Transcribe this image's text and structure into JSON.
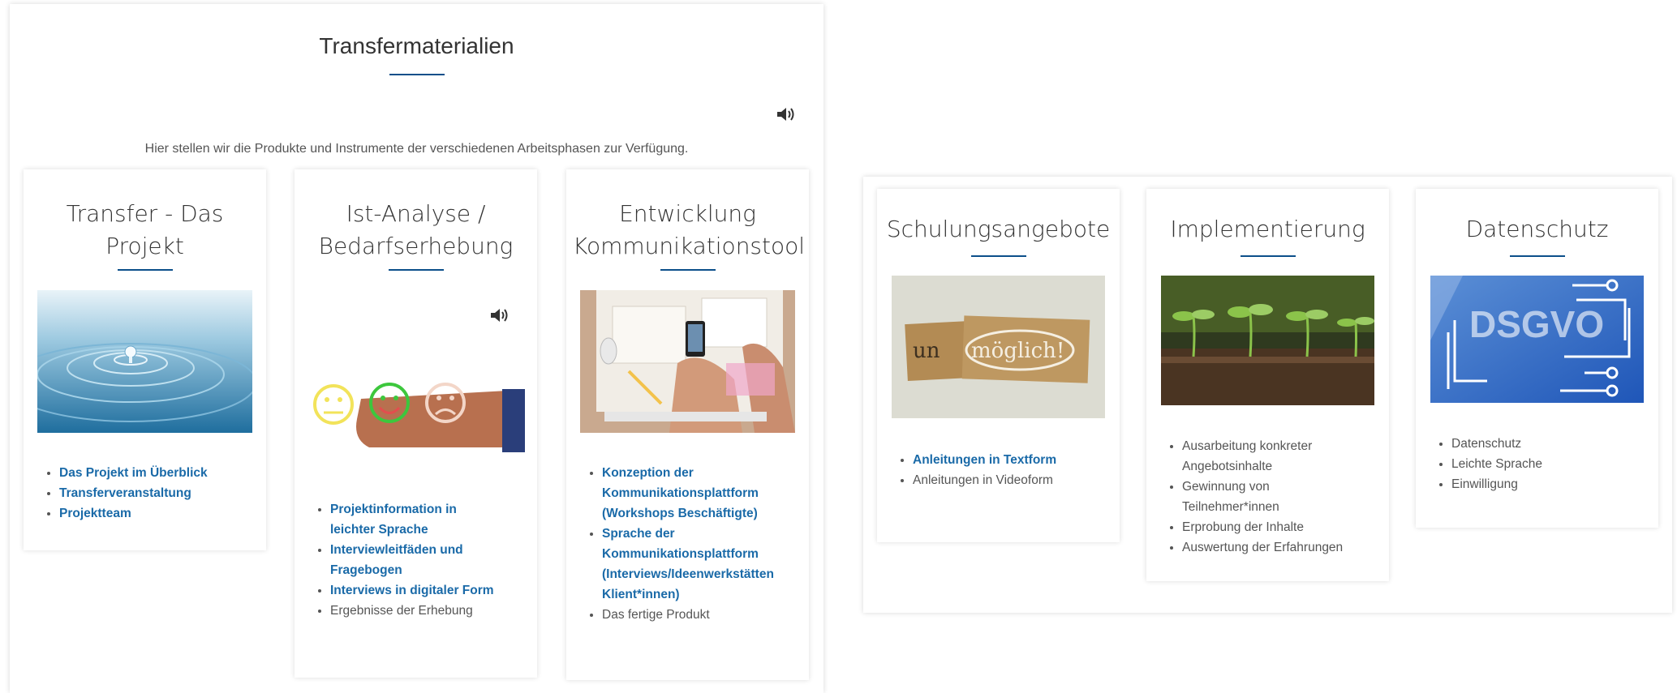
{
  "left_panel": {
    "title": "Transfermaterialien",
    "intro": "Hier stellen wir die Produkte und Instrumente der verschiedenen Arbeitsphasen zur Verfügung.",
    "cards": [
      {
        "title_line1": "Transfer - Das",
        "title_line2": "Projekt",
        "items": [
          {
            "text": "Das Projekt im Überblick",
            "link": true
          },
          {
            "text": "Transferveranstaltung",
            "link": true
          },
          {
            "text": "Projektteam",
            "link": true
          }
        ]
      },
      {
        "title_line1": "Ist-Analyse /",
        "title_line2": "Bedarfserhebung",
        "items": [
          {
            "line1": "Projektinformation in",
            "line2": "leichter Sprache",
            "link": true
          },
          {
            "line1": "Interviewleitfäden und",
            "line2": "Fragebogen",
            "link": true
          },
          {
            "text": "Interviews in digitaler Form",
            "link": true
          },
          {
            "text": "Ergebnisse der Erhebung",
            "link": false
          }
        ]
      },
      {
        "title_line1": "Entwicklung",
        "title_line2": "Kommunikationstool",
        "items": [
          {
            "line1": "Konzeption der",
            "line2": "Kommunikationsplattform",
            "line3": "(Workshops Beschäftigte)",
            "link": true
          },
          {
            "line1": "Sprache der",
            "line2": "Kommunikationsplattform",
            "line3": "(Interviews/Ideenwerkstätten",
            "line4": "Klient*innen)",
            "link": true
          },
          {
            "text": "Das fertige Produkt",
            "link": false
          }
        ]
      }
    ]
  },
  "right_panel": {
    "cards": [
      {
        "title": "Schulungsangebote",
        "image_text_1": "un",
        "image_text_2": "möglich!",
        "items": [
          {
            "text": "Anleitungen in Textform",
            "link": true
          },
          {
            "text": "Anleitungen in Videoform",
            "link": false
          }
        ]
      },
      {
        "title": "Implementierung",
        "items": [
          {
            "line1": "Ausarbeitung konkreter",
            "line2": "Angebotsinhalte",
            "link": false
          },
          {
            "line1": "Gewinnung von",
            "line2": "Teilnehmer*innen",
            "link": false
          },
          {
            "text": "Erprobung der Inhalte",
            "link": false
          },
          {
            "text": "Auswertung der Erfahrungen",
            "link": false
          }
        ]
      },
      {
        "title": "Datenschutz",
        "image_text": "DSGVO",
        "items": [
          {
            "text": "Datenschutz",
            "link": false
          },
          {
            "text": "Leichte Sprache",
            "link": false
          },
          {
            "text": "Einwilligung",
            "link": false
          }
        ]
      }
    ]
  },
  "colors": {
    "accent_underline": "#0c4f8a",
    "link": "#1a6aa8",
    "text": "#555555"
  },
  "icons": {
    "audio": "speaker-volume-icon"
  }
}
